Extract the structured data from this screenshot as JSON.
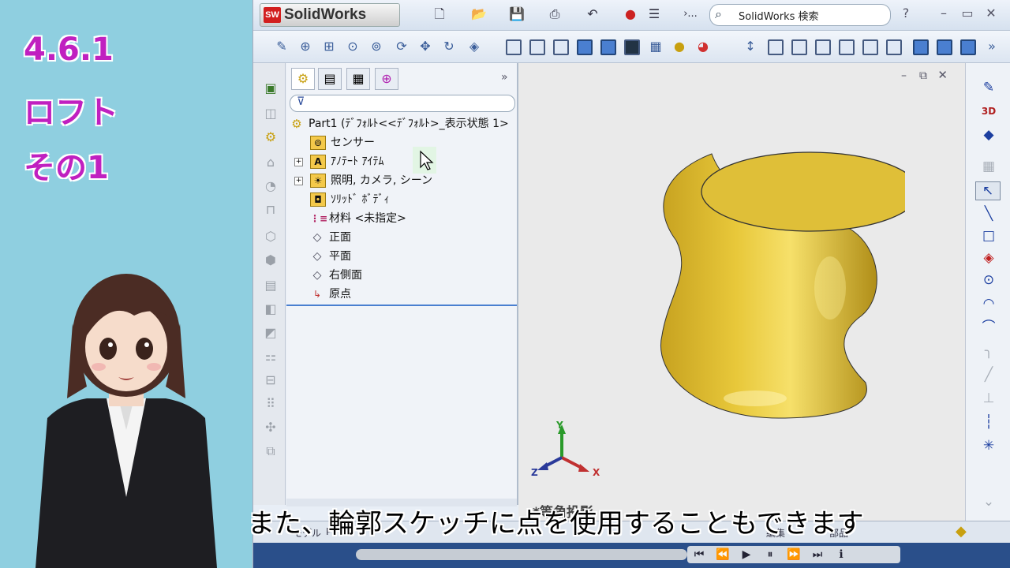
{
  "side_title": {
    "line1": "4.6.1",
    "line2": "ロフト",
    "line3": "その1"
  },
  "app": {
    "name": "SolidWorks",
    "logo_badge": "SW",
    "search_placeholder": "SolidWorks 検索",
    "help_label": "?",
    "more_label": "›..."
  },
  "feature_manager": {
    "root": "Part1 (ﾃﾞﾌｫﾙﾄ<<ﾃﾞﾌｫﾙﾄ>_表示状態 1>",
    "items": [
      {
        "label": "センサー",
        "icon": "sensor-icon"
      },
      {
        "label": "ｱﾉﾃｰﾄ ｱｲﾃﾑ",
        "icon": "annotation-icon"
      },
      {
        "label": "照明, カメラ, シーン",
        "icon": "lights-icon"
      },
      {
        "label": "ｿﾘｯﾄﾞ ﾎﾞﾃﾞｨ",
        "icon": "solid-bodies-icon"
      },
      {
        "label": "材料 <未指定>",
        "icon": "material-icon"
      },
      {
        "label": "正面",
        "icon": "plane-icon"
      },
      {
        "label": "平面",
        "icon": "plane-icon"
      },
      {
        "label": "右側面",
        "icon": "plane-icon"
      },
      {
        "label": "原点",
        "icon": "origin-icon"
      }
    ]
  },
  "viewport": {
    "axis_x": "X",
    "axis_y": "Y",
    "axis_z": "Z",
    "view_label": "*等角投影"
  },
  "status": {
    "tab_model": "モデル",
    "tab_3d": "Pr",
    "tab_sketch": "編集",
    "status_text": "部品"
  },
  "caption": "また、輪郭スケッチに点を使用することもできます",
  "colors": {
    "model_fill": "#e3c33a",
    "title_purple": "#c020c0",
    "side_bg": "#8fcfe0"
  }
}
